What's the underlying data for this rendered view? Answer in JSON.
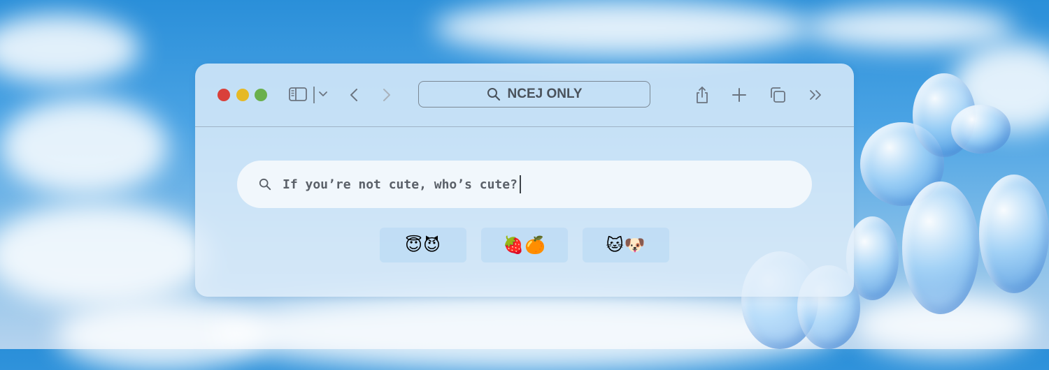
{
  "browser": {
    "address_text": "NCEJ ONLY",
    "toolbar_icons": [
      "sidebar-icon",
      "chevron-down-icon",
      "back-arrow-icon",
      "forward-arrow-icon",
      "search-icon",
      "share-icon",
      "plus-icon",
      "tabs-icon",
      "double-chevron-right-icon"
    ],
    "traffic_lights": {
      "close": "#d9403a",
      "minimize": "#e6b925",
      "zoom": "#6ab04c"
    }
  },
  "search": {
    "query": "If you’re not cute, who’s cute?"
  },
  "chips": [
    {
      "emoji": "😇😈"
    },
    {
      "emoji": "🍓🍊"
    },
    {
      "emoji": "🐱🐶"
    }
  ]
}
